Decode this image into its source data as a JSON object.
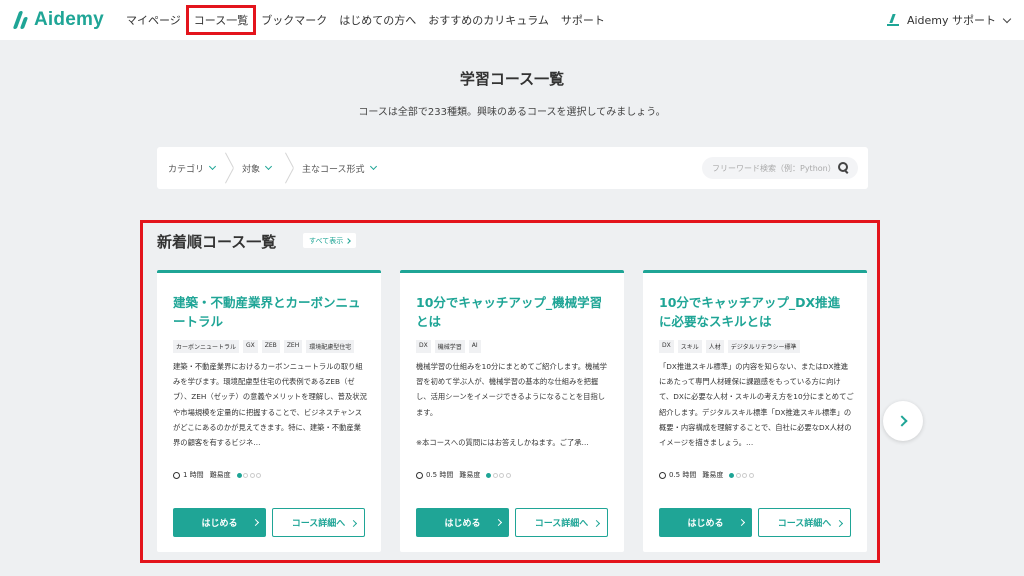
{
  "header": {
    "logo_text": "Aidemy",
    "nav": [
      {
        "label": "マイページ"
      },
      {
        "label": "コース一覧"
      },
      {
        "label": "ブックマーク"
      },
      {
        "label": "はじめての方へ"
      },
      {
        "label": "おすすめのカリキュラム"
      },
      {
        "label": "サポート"
      }
    ],
    "account_label": "Aidemy サポート"
  },
  "page": {
    "title": "学習コース一覧",
    "subtitle": "コースは全部で233種類。興味のあるコースを選択してみましょう。"
  },
  "filter": {
    "category": "カテゴリ",
    "target": "対象",
    "format": "主なコース形式",
    "search_placeholder": "フリーワード検索（例：Python）"
  },
  "section": {
    "title": "新着順コース一覧",
    "show_all": "すべて表示"
  },
  "cards": [
    {
      "title": "建築・不動産業界とカーボンニュートラル",
      "tags": [
        "カーボンニュートラル",
        "GX",
        "ZEB",
        "ZEH",
        "環境配慮型住宅"
      ],
      "desc": "建築・不動産業界におけるカーボンニュートラルの取り組みを学びます。環境配慮型住宅の代表例であるZEB（ゼブ）、ZEH（ゼッチ）の意義やメリットを理解し、普及状況や市場規模を定量的に把握することで、ビジネスチャンスがどこにあるのかが見えてきます。特に、建築・不動産業界の顧客を有するビジネ…",
      "time": "1 時間",
      "difficulty_label": "難易度",
      "difficulty": 1,
      "start": "はじめる",
      "detail": "コース詳細へ"
    },
    {
      "title": "10分でキャッチアップ_機械学習とは",
      "tags": [
        "DX",
        "機械学習",
        "AI"
      ],
      "desc": "機械学習の仕組みを10分にまとめてご紹介します。機械学習を初めて学ぶ人が、機械学習の基本的な仕組みを把握し、活用シーンをイメージできるようになることを目指します。\n\n※本コースへの質問にはお答えしかねます。ご了承…",
      "time": "0.5 時間",
      "difficulty_label": "難易度",
      "difficulty": 1,
      "start": "はじめる",
      "detail": "コース詳細へ"
    },
    {
      "title": "10分でキャッチアップ_DX推進に必要なスキルとは",
      "tags": [
        "DX",
        "スキル",
        "人材",
        "デジタルリテラシー標準"
      ],
      "desc": "「DX推進スキル標準」の内容を知らない、またはDX推進にあたって専門人材確保に課題感をもっている方に向けて、DXに必要な人材・スキルの考え方を10分にまとめてご紹介します。デジタルスキル標準「DX推進スキル標準」の概要・内容構成を理解することで、自社に必要なDX人材のイメージを描きましょう。…",
      "time": "0.5 時間",
      "difficulty_label": "難易度",
      "difficulty": 1,
      "start": "はじめる",
      "detail": "コース詳細へ"
    }
  ],
  "colors": {
    "accent": "#1fa596",
    "highlight": "#e3141c",
    "background": "#eef0f2"
  }
}
